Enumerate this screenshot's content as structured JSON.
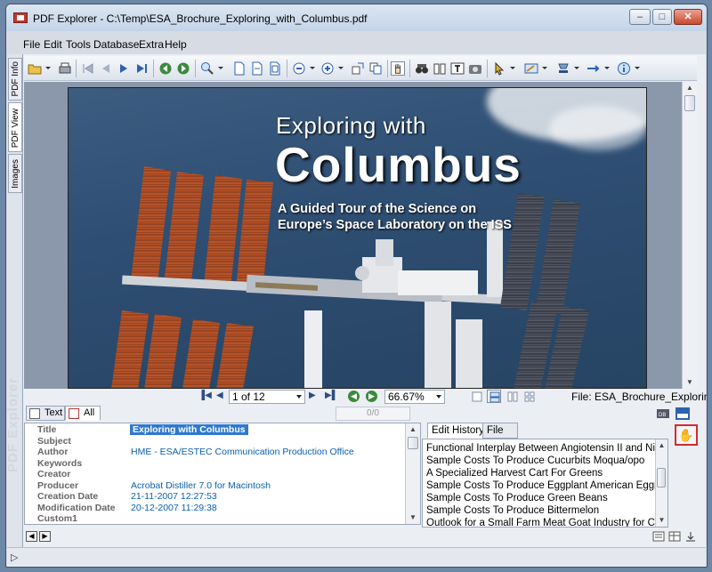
{
  "window": {
    "title": "PDF Explorer - C:\\Temp\\ESA_Brochure_Exploring_with_Columbus.pdf",
    "controls": {
      "minimize": "–",
      "maximize": "□",
      "close": "✕"
    }
  },
  "menu": {
    "items": [
      "File",
      "Edit",
      "Tools",
      "Database",
      "Extra",
      "Help"
    ]
  },
  "side_tabs": {
    "items": [
      "PDF Info",
      "PDF View",
      "Images"
    ],
    "watermark": "PDF Explorer"
  },
  "toolbar": {
    "icons": [
      "open-folder-icon",
      "print-icon",
      "first-page-icon",
      "prev-page-icon",
      "next-page-icon",
      "last-page-icon",
      "back-icon",
      "forward-icon",
      "zoom-icon",
      "page-icon",
      "page-width-icon",
      "page-fit-icon",
      "zoom-out-icon",
      "zoom-in-icon",
      "rotate-icon",
      "copy-icon",
      "hand-tool-icon",
      "binoculars-icon",
      "text-select-icon",
      "snapshot-icon",
      "pointer-icon",
      "edit-icon",
      "stamp-icon",
      "link-icon",
      "info-icon"
    ]
  },
  "document": {
    "cover_line1": "Exploring with",
    "cover_line2": "Columbus",
    "cover_line3": "A Guided Tour of the Science on",
    "cover_line4": "Europe’s Space Laboratory on the ISS"
  },
  "nav": {
    "page_indicator": "1 of 12",
    "zoom": "66.67%",
    "file_label": "File: ESA_Brochure_Exploring_w"
  },
  "panel": {
    "tabs": [
      "Text",
      "All"
    ],
    "counter": "0/0"
  },
  "info": {
    "rows": [
      {
        "label": "Title",
        "value": "Exploring with Columbus"
      },
      {
        "label": "Subject",
        "value": ""
      },
      {
        "label": "Author",
        "value": "HME - ESA/ESTEC Communication Production Office"
      },
      {
        "label": "Keywords",
        "value": ""
      },
      {
        "label": "Creator",
        "value": ""
      },
      {
        "label": "Producer",
        "value": "Acrobat Distiller 7.0 for Macintosh"
      },
      {
        "label": "Creation Date",
        "value": "21-11-2007 12:27:53"
      },
      {
        "label": "Modification Date",
        "value": "20-12-2007 11:29:38"
      },
      {
        "label": "Custom1",
        "value": ""
      }
    ]
  },
  "history": {
    "tabs": [
      "Edit History",
      "File"
    ],
    "items": [
      "Functional Interplay Between Angiotensin II and Nitric O",
      "Sample Costs To Produce Cucurbits Moqua/opo",
      "A Specialized Harvest Cart For Greens",
      "Sample Costs To Produce Eggplant American Eggplant",
      "Sample Costs To Produce Green Beans",
      "Sample Costs To Produce Bittermelon",
      "Outlook for a Small Farm Meat Goat Industry for Califor"
    ]
  },
  "colors": {
    "accent": "#2f78d0",
    "link": "#0b5fae",
    "highlight_border": "#d12d2d"
  }
}
